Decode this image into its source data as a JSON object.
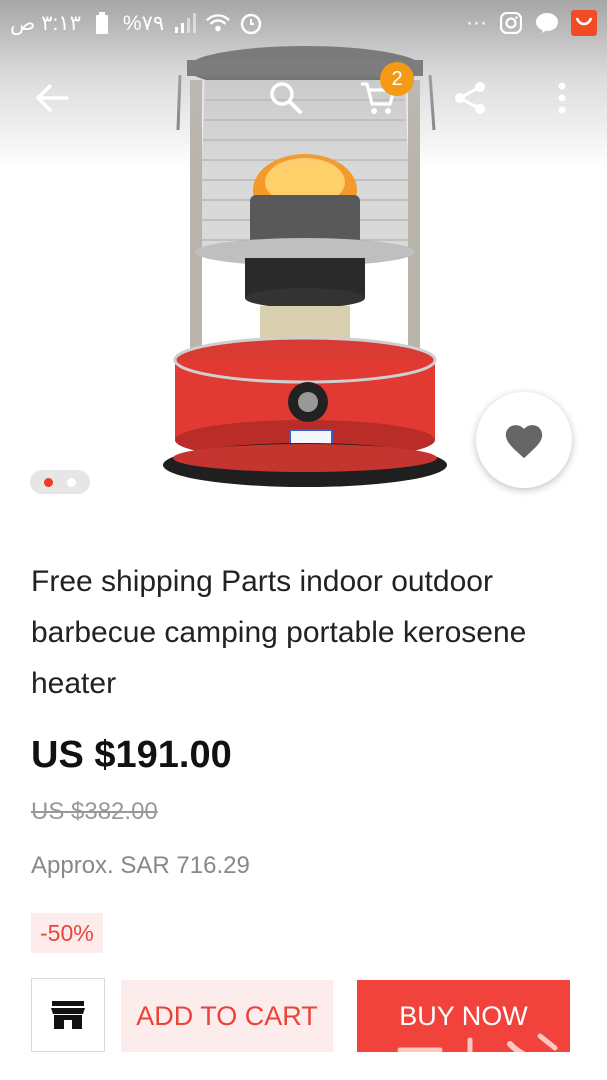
{
  "status_bar": {
    "time": "٣:١٣ ص",
    "battery": "%٧٩",
    "dots": "···",
    "icons": [
      "battery-icon",
      "signal-icon",
      "wifi-icon",
      "alarm-icon",
      "instagram-icon",
      "line-icon",
      "aliexpress-icon"
    ]
  },
  "toolbar": {
    "icons": [
      "back-arrow-icon",
      "search-icon",
      "cart-icon",
      "share-icon",
      "more-vert-icon"
    ],
    "cart_count": "2"
  },
  "gallery": {
    "image": "kerosene-heater-photo",
    "pager_total": 2,
    "pager_active": 1
  },
  "product": {
    "title": "Free shipping Parts indoor outdoor barbecue camping portable kerosene heater",
    "price": "US $191.00",
    "original_price": "US $382.00",
    "approx_price": "Approx. SAR 716.29",
    "discount": "-50%"
  },
  "actions": {
    "store_icon": "store-icon",
    "add_to_cart": "ADD TO CART",
    "buy_now": "BUY NOW"
  },
  "colors": {
    "accent_red": "#f1433b",
    "light_red": "#fdecec",
    "badge_orange": "#f59a14"
  }
}
